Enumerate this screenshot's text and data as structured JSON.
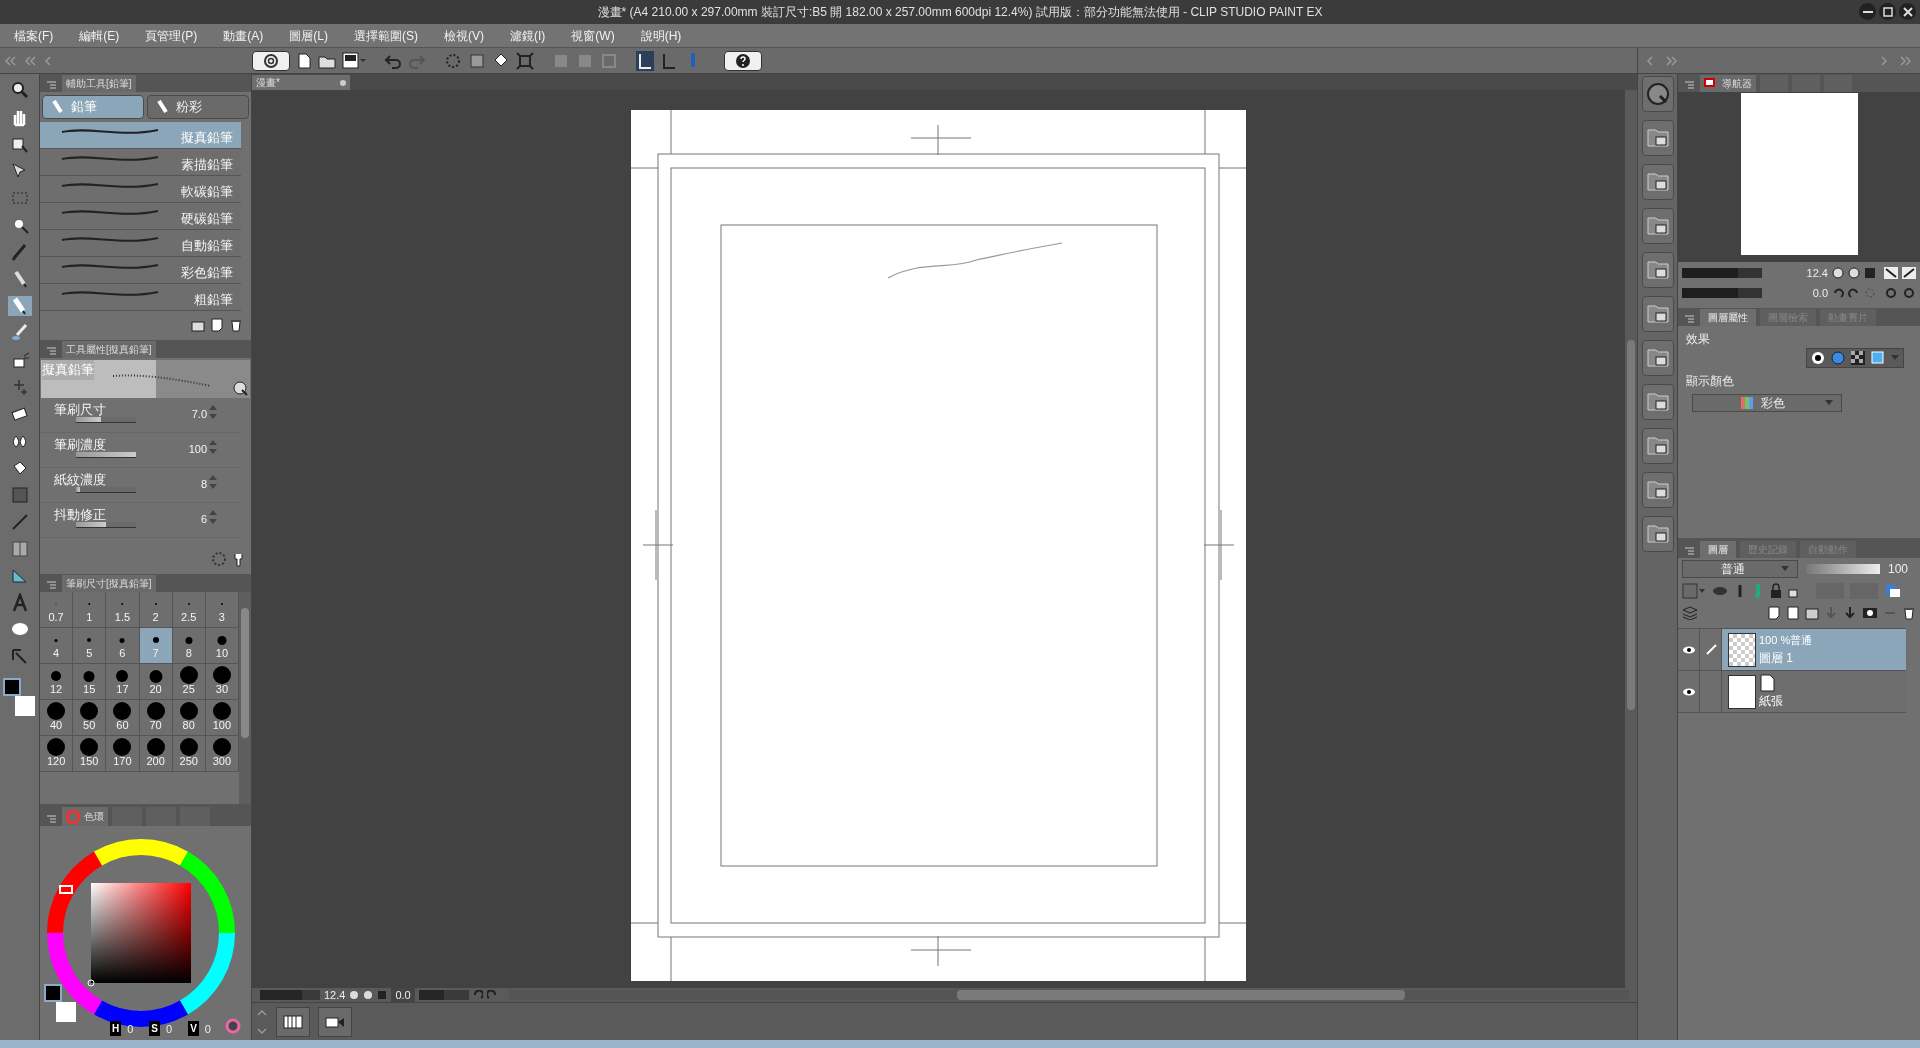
{
  "window": {
    "title": "漫畫* (A4 210.00 x 297.00mm 裝訂尺寸:B5 開 182.00 x 257.00mm 600dpi 12.4%)  試用版：部分功能無法使用 - CLIP STUDIO PAINT EX"
  },
  "menu": [
    "檔案(F)",
    "編輯(E)",
    "頁管理(P)",
    "動畫(A)",
    "圖層(L)",
    "選擇範圍(S)",
    "檢視(V)",
    "濾鏡(I)",
    "視窗(W)",
    "說明(H)"
  ],
  "document_tab": {
    "label": "漫畫*"
  },
  "sub_tool_panel": {
    "title": "輔助工具[鉛筆]",
    "groups": [
      {
        "label": "鉛筆",
        "selected": true
      },
      {
        "label": "粉彩",
        "selected": false
      }
    ],
    "brushes": [
      {
        "label": "擬真鉛筆",
        "selected": true
      },
      {
        "label": "素描鉛筆",
        "selected": false
      },
      {
        "label": "軟碳鉛筆",
        "selected": false
      },
      {
        "label": "硬碳鉛筆",
        "selected": false
      },
      {
        "label": "自動鉛筆",
        "selected": false
      },
      {
        "label": "彩色鉛筆",
        "selected": false
      },
      {
        "label": "粗鉛筆",
        "selected": false
      }
    ]
  },
  "tool_property": {
    "title": "工具屬性[擬真鉛筆]",
    "preview_label": "擬真鉛筆",
    "properties": [
      {
        "label": "筆刷尺寸",
        "value": "7.0",
        "level": 0.42
      },
      {
        "label": "筆刷濃度",
        "value": "100",
        "level": 1
      },
      {
        "label": "紙紋濃度",
        "value": "8",
        "level": 0.06
      },
      {
        "label": "抖動修正",
        "value": "6",
        "level": 0.5
      }
    ]
  },
  "brush_size": {
    "title": "筆刷尺寸[擬真鉛筆]",
    "sizes": [
      {
        "label": "0.7",
        "selected": false
      },
      {
        "label": "1",
        "selected": false
      },
      {
        "label": "1.5",
        "selected": false
      },
      {
        "label": "2",
        "selected": false
      },
      {
        "label": "2.5",
        "selected": false
      },
      {
        "label": "3",
        "selected": false
      },
      {
        "label": "4",
        "selected": false
      },
      {
        "label": "5",
        "selected": false
      },
      {
        "label": "6",
        "selected": false
      },
      {
        "label": "7",
        "selected": true
      },
      {
        "label": "8",
        "selected": false
      },
      {
        "label": "10",
        "selected": false
      },
      {
        "label": "12",
        "selected": false
      },
      {
        "label": "15",
        "selected": false
      },
      {
        "label": "17",
        "selected": false
      },
      {
        "label": "20",
        "selected": false
      },
      {
        "label": "25",
        "selected": false
      },
      {
        "label": "30",
        "selected": false
      },
      {
        "label": "40",
        "selected": false
      },
      {
        "label": "50",
        "selected": false
      },
      {
        "label": "60",
        "selected": false
      },
      {
        "label": "70",
        "selected": false
      },
      {
        "label": "80",
        "selected": false
      },
      {
        "label": "100",
        "selected": false
      },
      {
        "label": "120",
        "selected": false
      },
      {
        "label": "150",
        "selected": false
      },
      {
        "label": "170",
        "selected": false
      },
      {
        "label": "200",
        "selected": false
      },
      {
        "label": "250",
        "selected": false
      },
      {
        "label": "300",
        "selected": false
      }
    ]
  },
  "color_panel": {
    "tab": "色環",
    "readings": [
      {
        "label": "H",
        "value": "0"
      },
      {
        "label": "S",
        "value": "0"
      },
      {
        "label": "V",
        "value": "0"
      }
    ]
  },
  "navigator": {
    "tab": "導航器",
    "zoom": {
      "value": "12.4",
      "level": 0.7
    },
    "angle": {
      "value": "0.0",
      "level": 0.7
    }
  },
  "layer_property": {
    "tabs": [
      {
        "label": "圖層屬性",
        "selected": true
      },
      {
        "label": "圖層檢索",
        "selected": false
      },
      {
        "label": "動畫賽片",
        "selected": false
      }
    ],
    "effect_label": "效果",
    "display_color_label": "顯示顏色",
    "display_color_value": "彩色"
  },
  "layers_panel": {
    "tabs": [
      {
        "label": "圖層",
        "selected": true
      },
      {
        "label": "歷史記錄",
        "selected": false
      },
      {
        "label": "自動動作",
        "selected": false
      }
    ],
    "blend_mode": "普通",
    "opacity": {
      "value": "100",
      "level": 1
    },
    "layers": [
      {
        "info": "100 %普通",
        "name": "圖層 1",
        "selected": true,
        "kind": "raster"
      },
      {
        "name": "紙張",
        "selected": false,
        "kind": "paper"
      }
    ]
  },
  "canvas_status": {
    "zoom": {
      "value": "12.4",
      "level": 0.7
    },
    "angle": {
      "value": "0.0",
      "level": 0.5
    }
  }
}
